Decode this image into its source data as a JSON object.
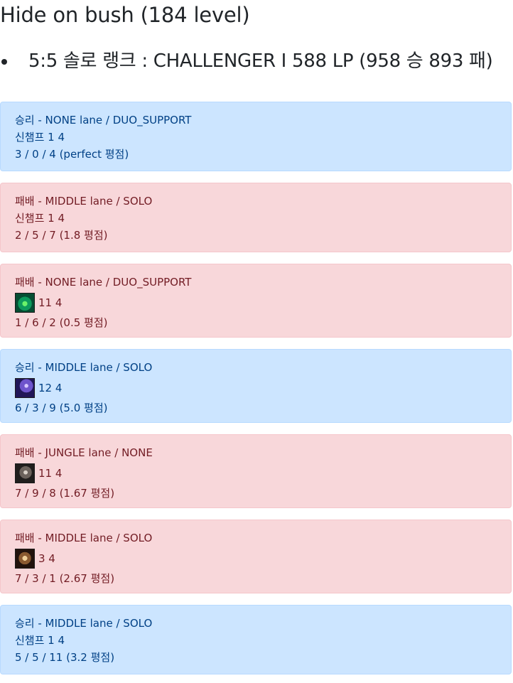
{
  "summoner": {
    "title": "Hide on bush (184 level)"
  },
  "rank": {
    "text": "5:5 솔로 랭크 : CHALLENGER I 588 LP (958 승 893 패)"
  },
  "matches": [
    {
      "result_line": "승리 - NONE lane / DUO_SUPPORT",
      "champion_text": "신챔프 1 4",
      "kda_text": "3 / 0 / 4 (perfect 평점)",
      "result_type": "win"
    },
    {
      "result_line": "패배 - MIDDLE lane / SOLO",
      "champion_text": "신챔프 1 4",
      "kda_text": "2 / 5 / 7 (1.8 평점)",
      "result_type": "loss"
    },
    {
      "result_line": "패배 - NONE lane / DUO_SUPPORT",
      "champion_text": "11 4",
      "champion_icon": "champion-green-icon",
      "kda_text": "1 / 6 / 2 (0.5 평점)",
      "result_type": "loss"
    },
    {
      "result_line": "승리 - MIDDLE lane / SOLO",
      "champion_text": "12 4",
      "champion_icon": "champion-purple-icon",
      "kda_text": "6 / 3 / 9 (5.0 평점)",
      "result_type": "win"
    },
    {
      "result_line": "패배 - JUNGLE lane / NONE",
      "champion_text": "11 4",
      "champion_icon": "champion-gray-icon",
      "kda_text": "7 / 9 / 8 (1.67 평점)",
      "result_type": "loss"
    },
    {
      "result_line": "패배 - MIDDLE lane / SOLO",
      "champion_text": "3 4",
      "champion_icon": "champion-brown-icon",
      "kda_text": "7 / 3 / 1 (2.67 평점)",
      "result_type": "loss"
    },
    {
      "result_line": "승리 - MIDDLE lane / SOLO",
      "champion_text": "신챔프 1 4",
      "kda_text": "5 / 5 / 11 (3.2 평점)",
      "result_type": "win"
    }
  ],
  "colors": {
    "win_background": "#cce5ff",
    "win_border": "#b8daff",
    "win_text": "#004085",
    "loss_background": "#f8d7da",
    "loss_border": "#f5c6cb",
    "loss_text": "#721c24"
  }
}
